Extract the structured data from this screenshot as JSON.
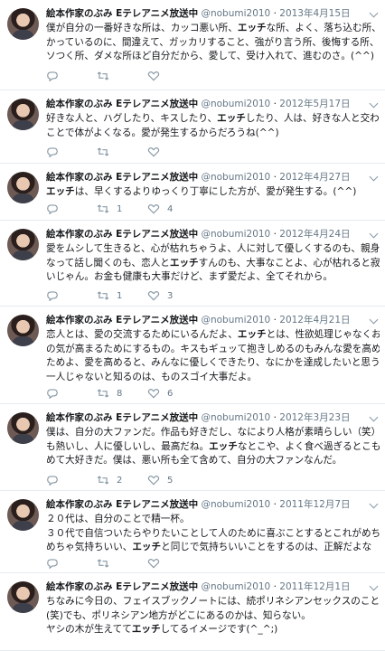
{
  "tweets": [
    {
      "name": "絵本作家のぶみ Eテレアニメ放送中",
      "handle": "@nobumi2010",
      "date": "2013年4月15日",
      "lines": [
        [
          {
            "t": "僕が自分の一番好きな所は、カッコ悪い所、"
          },
          {
            "t": "エッチ",
            "b": true
          },
          {
            "t": "な所、よく、落ち込む所、わ"
          }
        ],
        [
          {
            "t": "かっているのに、間違えて、ガッカリすること、強がり言う所、後悔する所、ウ"
          }
        ],
        [
          {
            "t": "ソつく所、ダメな所ほど自分だから、愛して、受け入れて、進むのさ。(^^)"
          }
        ]
      ],
      "reply_count": "",
      "retweet_count": "",
      "like_count": ""
    },
    {
      "name": "絵本作家のぶみ Eテレアニメ放送中",
      "handle": "@nobumi2010",
      "date": "2012年5月17日",
      "lines": [
        [
          {
            "t": "好きな人と、ハグしたり、キスしたり、"
          },
          {
            "t": "エッチ",
            "b": true
          },
          {
            "t": "したり、人は、好きな人と交わる"
          }
        ],
        [
          {
            "t": "ことで体がよくなる。愛が発生するからだろうね(^^)"
          }
        ]
      ],
      "reply_count": "",
      "retweet_count": "",
      "like_count": ""
    },
    {
      "name": "絵本作家のぶみ Eテレアニメ放送中",
      "handle": "@nobumi2010",
      "date": "2012年4月27日",
      "lines": [
        [
          {
            "t": "エッチ",
            "b": true
          },
          {
            "t": "は、早くするよりゆっくり丁寧にした方が、愛が発生する。(^^)"
          }
        ]
      ],
      "reply_count": "",
      "retweet_count": "1",
      "like_count": "4"
    },
    {
      "name": "絵本作家のぶみ Eテレアニメ放送中",
      "handle": "@nobumi2010",
      "date": "2012年4月24日",
      "lines": [
        [
          {
            "t": "愛をムシして生きると、心が枯れちゃうよ、人に対して優しくするのも、親身に"
          }
        ],
        [
          {
            "t": "なって話し聞くのも、恋人と"
          },
          {
            "t": "エッチ",
            "b": true
          },
          {
            "t": "すんのも、大事なことよ、心が枯れると寂し"
          }
        ],
        [
          {
            "t": "いじゃん。お金も健康も大事だけど、まず愛だよ、全てそれから。"
          }
        ]
      ],
      "reply_count": "",
      "retweet_count": "1",
      "like_count": "3"
    },
    {
      "name": "絵本作家のぶみ Eテレアニメ放送中",
      "handle": "@nobumi2010",
      "date": "2012年4月21日",
      "lines": [
        [
          {
            "t": "恋人とは、愛の交流するためにいるんだよ、"
          },
          {
            "t": "エッチ",
            "b": true
          },
          {
            "t": "とは、性欲処理じゃなくお互い"
          }
        ],
        [
          {
            "t": "の気が高まるためにするもの。キスもギュッて抱きしめるのもみんな愛を高める"
          }
        ],
        [
          {
            "t": "ためよ、愛を高めると、みんなに優しくできたり、なにかを達成したいと思う。"
          }
        ],
        [
          {
            "t": "一人じゃないと知るのは、ものスゴイ大事だよ。"
          }
        ]
      ],
      "reply_count": "",
      "retweet_count": "8",
      "like_count": "6"
    },
    {
      "name": "絵本作家のぶみ Eテレアニメ放送中",
      "handle": "@nobumi2010",
      "date": "2012年3月23日",
      "lines": [
        [
          {
            "t": "僕は、自分の大ファンだ。作品も好きだし、なにより人格が素晴らしい（笑）情"
          }
        ],
        [
          {
            "t": "も熱いし、人に優しいし、最高だね。"
          },
          {
            "t": "エッチ",
            "b": true
          },
          {
            "t": "なとこや、よく食べ過ぎるとこも含"
          }
        ],
        [
          {
            "t": "めて大好きだ。僕は、悪い所も全て含めて、自分の大ファンなんだ。"
          }
        ]
      ],
      "reply_count": "",
      "retweet_count": "2",
      "like_count": "5"
    },
    {
      "name": "絵本作家のぶみ Eテレアニメ放送中",
      "handle": "@nobumi2010",
      "date": "2011年12月7日",
      "lines": [
        [
          {
            "t": "２０代は、自分のことで精一杯。"
          }
        ],
        [
          {
            "t": "３０代で自信ついたらやりたいことして人のために喜ぶことするとこれがめちゃ"
          }
        ],
        [
          {
            "t": "めちゃ気持ちいい、"
          },
          {
            "t": "エッチ",
            "b": true
          },
          {
            "t": "と同じで気持ちいいことをするのは、正解だよな"
          }
        ]
      ],
      "reply_count": "",
      "retweet_count": "",
      "like_count": ""
    },
    {
      "name": "絵本作家のぶみ Eテレアニメ放送中",
      "handle": "@nobumi2010",
      "date": "2011年12月1日",
      "lines": [
        [
          {
            "t": "ちなみに今日の、フェイスブックノートには、続ポリネシアンセックスのことが"
          }
        ],
        [
          {
            "t": "(笑)でも、ポリネシアン地方がどこにあるのかは、知らない。"
          }
        ],
        [
          {
            "t": "ヤシの木が生えてて"
          },
          {
            "t": "エッチ",
            "b": true
          },
          {
            "t": "してるイメージです(^_^;)"
          }
        ]
      ],
      "reply_count": "",
      "retweet_count": "",
      "like_count": ""
    }
  ],
  "icons": {
    "avatar": "profile-photo",
    "menu": "chevron-down-icon",
    "reply": "reply-icon",
    "retweet": "retweet-icon",
    "like": "heart-icon"
  },
  "colors": {
    "name": "#14171a",
    "meta": "#657786",
    "divider": "#e6ecf0",
    "icon": "#8899a6"
  }
}
